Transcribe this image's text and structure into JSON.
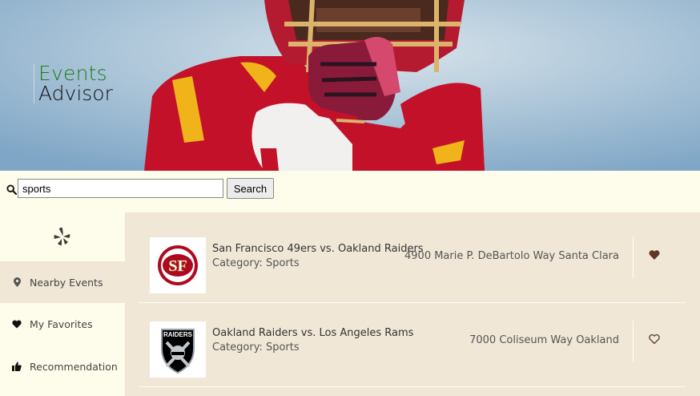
{
  "brand": {
    "line1": "Events",
    "line2": "Advisor"
  },
  "search": {
    "value": "sports",
    "button_label": "Search"
  },
  "sidebar": {
    "items": [
      {
        "label": "Nearby Events",
        "icon": "map-marker-icon",
        "active": true
      },
      {
        "label": "My Favorites",
        "icon": "heart-icon",
        "active": false
      },
      {
        "label": "Recommendation",
        "icon": "thumbs-up-icon",
        "active": false
      }
    ]
  },
  "events": [
    {
      "title": "San Francisco 49ers vs. Oakland Raiders",
      "category": "Category: Sports",
      "address": "4900 Marie P. DeBartolo Way Santa Clara",
      "favorite": true,
      "logo": "49ers-logo"
    },
    {
      "title": "Oakland Raiders vs. Los Angeles Rams",
      "category": "Category: Sports",
      "address": "7000 Coliseum Way Oakland",
      "favorite": false,
      "logo": "raiders-logo"
    }
  ],
  "colors": {
    "brand_green": "#1d7a1d",
    "cream": "#fefdeb",
    "beige": "#f0e7d6",
    "heart": "#5b3a29"
  }
}
